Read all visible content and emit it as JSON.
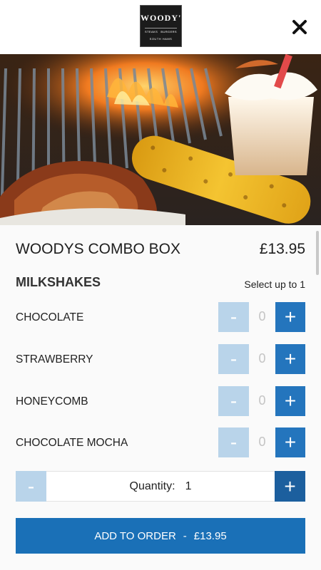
{
  "header": {
    "logo_text": "WOODY'S",
    "logo_sub_left": "STEAKS",
    "logo_sub_right": "BURGERS",
    "logo_location": "SOUTH HAMS",
    "close_icon": "close-icon"
  },
  "hero": {
    "image": "grill with corn, chicken and milkshake"
  },
  "product": {
    "title": "WOODYS COMBO BOX",
    "price": "£13.95"
  },
  "section": {
    "title": "MILKSHAKES",
    "hint": "Select up to 1"
  },
  "options": [
    {
      "label": "CHOCOLATE",
      "count": "0",
      "minus": "-",
      "plus": "+"
    },
    {
      "label": "STRAWBERRY",
      "count": "0",
      "minus": "-",
      "plus": "+"
    },
    {
      "label": "HONEYCOMB",
      "count": "0",
      "minus": "-",
      "plus": "+"
    },
    {
      "label": "CHOCOLATE MOCHA",
      "count": "0",
      "minus": "-",
      "plus": "+"
    }
  ],
  "quantity": {
    "label": "Quantity:",
    "value": "1",
    "minus": "-",
    "plus": "+"
  },
  "add_button": {
    "label": "ADD TO ORDER",
    "separator": "-",
    "price": "£13.95"
  },
  "colors": {
    "accent": "#1a70b7",
    "disabled": "#b9d4ea",
    "plus": "#2475bd"
  }
}
